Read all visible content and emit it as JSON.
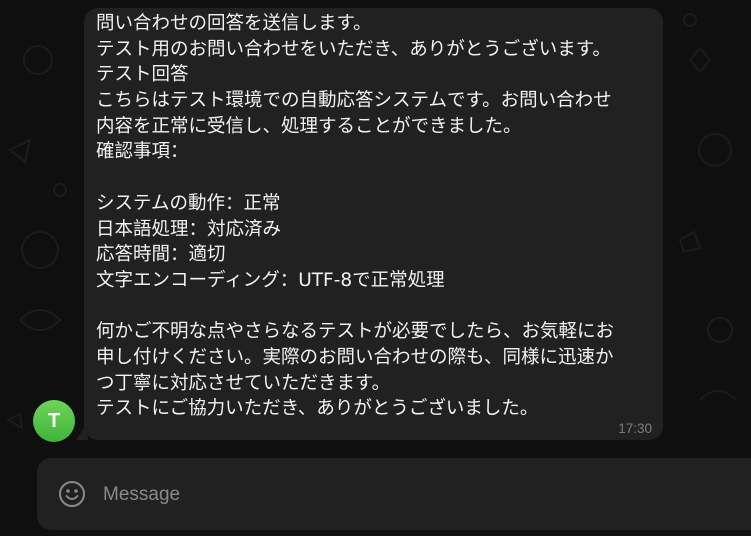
{
  "message": {
    "lines": [
      "問い合わせの回答を送信します。",
      "テスト用のお問い合わせをいただき、ありがとうございます。",
      "テスト回答",
      "こちらはテスト環境での自動応答システムです。お問い合わせ",
      "内容を正常に受信し、処理することができました。",
      "確認事項：",
      "",
      "システムの動作：正常",
      "日本語処理：対応済み",
      "応答時間：適切",
      "文字エンコーディング：UTF-8で正常処理",
      "",
      "何かご不明な点やさらなるテストが必要でしたら、お気軽にお",
      "申し付けください。実際のお問い合わせの際も、同様に迅速か",
      "つ丁寧に対応させていただきます。",
      "テストにご協力いただき、ありがとうございました。"
    ],
    "time": "17:30"
  },
  "sender": {
    "avatar_letter": "T",
    "avatar_color": "#4cbd3f"
  },
  "composer": {
    "placeholder": "Message",
    "emoji_icon": "smiley-icon"
  },
  "colors": {
    "background": "#0f0f0f",
    "bubble": "#212121",
    "text": "#f2f2f2",
    "timestamp": "#7d7d7d"
  }
}
